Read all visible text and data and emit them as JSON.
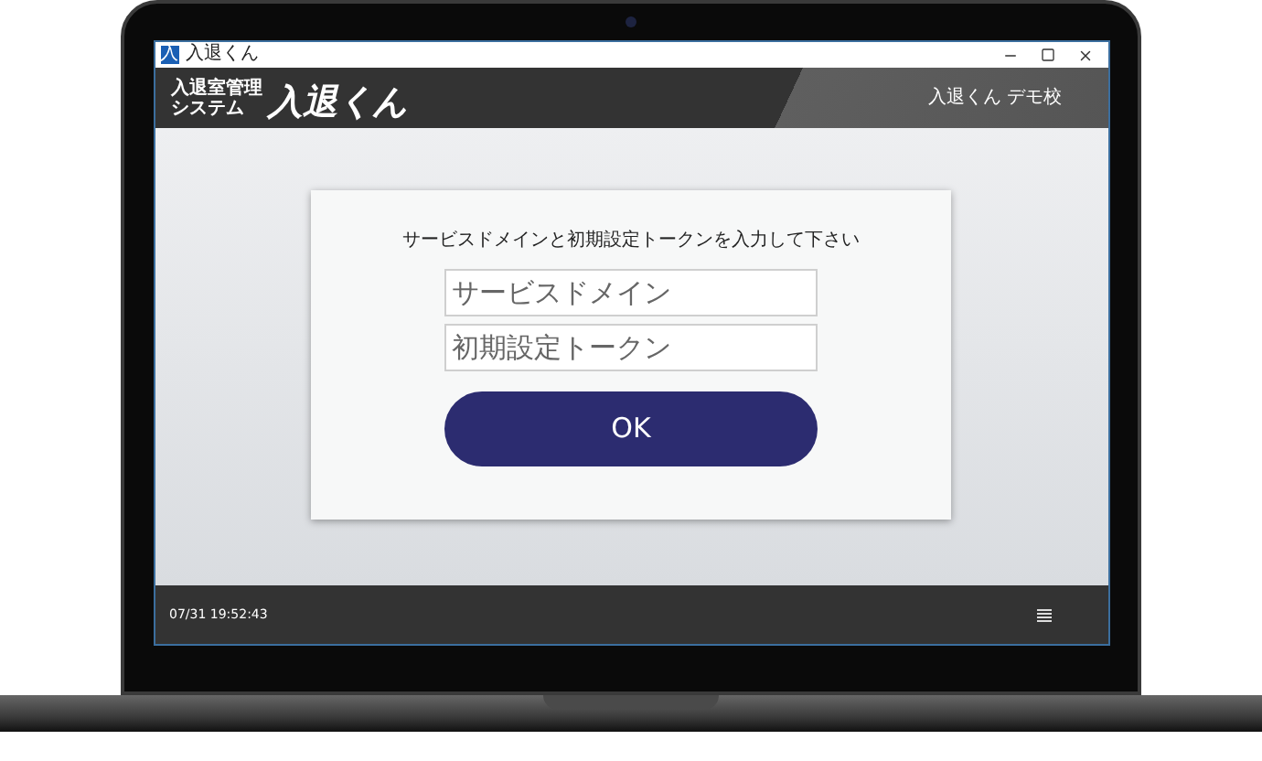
{
  "window": {
    "app_icon": "入",
    "title": "入退くん"
  },
  "header": {
    "logo_lines": [
      "入退室管理",
      "システム"
    ],
    "logo_name": "入退くん",
    "school": "入退くん デモ校"
  },
  "form": {
    "instruction": "サービスドメインと初期設定トークンを入力して下さい",
    "fields": [
      {
        "placeholder": "サービスドメイン"
      },
      {
        "placeholder": "初期設定トークン"
      }
    ],
    "button": "OK"
  },
  "status_bar": {
    "datetime": "07/31 19:52:43"
  }
}
